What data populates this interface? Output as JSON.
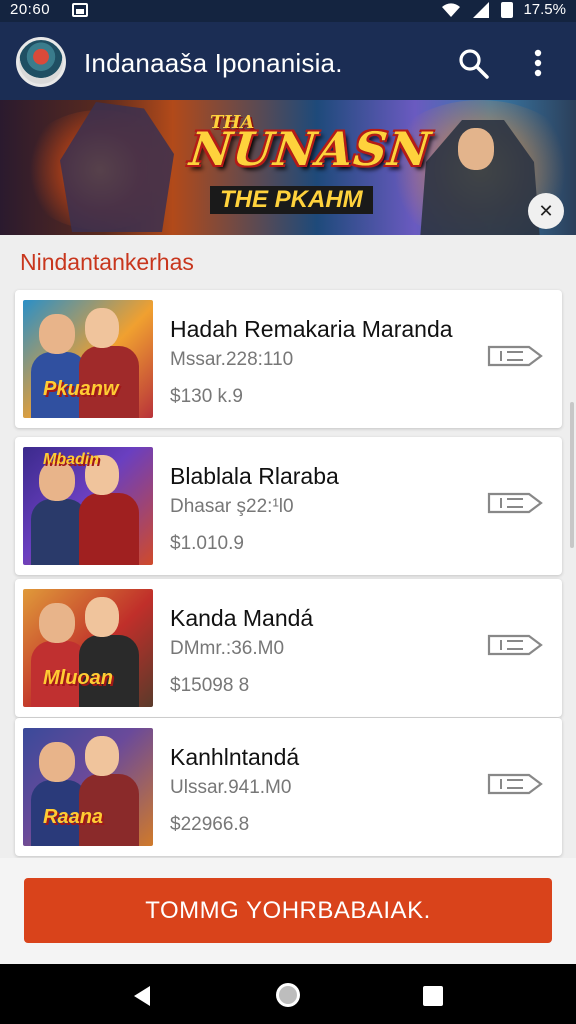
{
  "status_bar": {
    "time": "20:60",
    "battery": "17.5%"
  },
  "app_bar": {
    "title": "Indanaaša Iponanisia."
  },
  "banner": {
    "title": "NUNASN",
    "title_prefix": "THA",
    "subtitle": "THE PKAHM"
  },
  "section": {
    "title": "Nindantankerhas"
  },
  "items": [
    {
      "name": "Hadah Remakaria Maranda",
      "sub": "Mssar.228:110",
      "price": "$130 k.9",
      "colors": [
        "#2a8fc7",
        "#f0a030",
        "#b8323a"
      ]
    },
    {
      "name": "Blablala Rlaraba",
      "sub": "Dhasar ş22:¹l0",
      "price": "$1.010.9",
      "colors": [
        "#3b2a8c",
        "#d04a2a",
        "#6a3fc0"
      ]
    },
    {
      "name": "Kanda Mandá",
      "sub": "DMmr.:36.M0",
      "price": "$15098 8",
      "colors": [
        "#e09a3a",
        "#c02f2a",
        "#5a3a2a"
      ]
    },
    {
      "name": "Kanhlntandá",
      "sub": "Ulssar.941.M0",
      "price": "$22966.8",
      "colors": [
        "#3a4a9a",
        "#d07a2a",
        "#6a4a9a"
      ]
    }
  ],
  "cta": {
    "label": "TOMMG YOHRBABAIAK."
  }
}
